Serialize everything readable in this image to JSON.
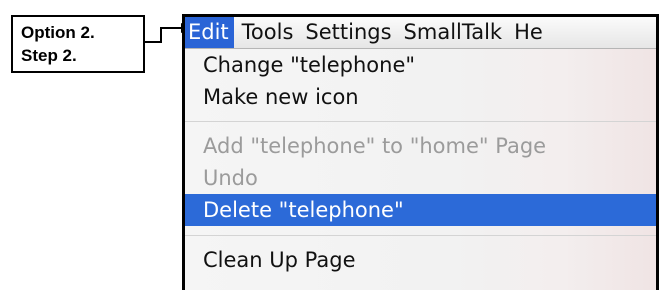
{
  "callout": {
    "line1": "Option 2.",
    "line2": "Step 2."
  },
  "menubar": {
    "items": [
      {
        "label": "Edit"
      },
      {
        "label": "Tools"
      },
      {
        "label": "Settings"
      },
      {
        "label": "SmallTalk"
      },
      {
        "label": "He"
      }
    ],
    "active_index": 0
  },
  "menu": {
    "items": [
      {
        "label": "Change \"telephone\"",
        "enabled": true
      },
      {
        "label": "Make new icon",
        "enabled": true
      },
      {
        "label": "Add \"telephone\" to \"home\" Page",
        "enabled": false
      },
      {
        "label": "Undo",
        "enabled": false
      },
      {
        "label": "Delete \"telephone\"",
        "enabled": true,
        "highlighted": true
      },
      {
        "label": "Clean Up Page",
        "enabled": true
      }
    ]
  },
  "colors": {
    "highlight": "#2c6ad8",
    "disabled_text": "#9b9b9b"
  }
}
